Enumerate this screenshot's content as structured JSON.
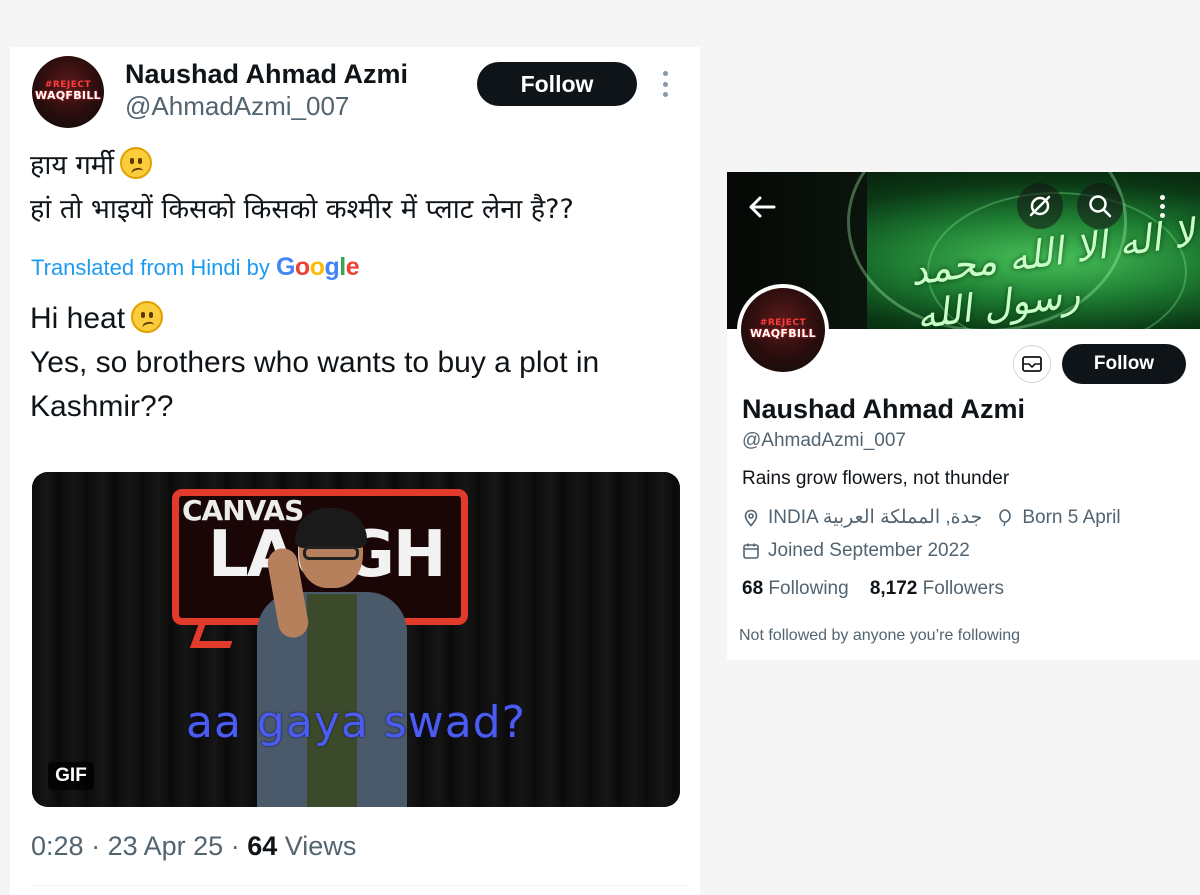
{
  "tweet": {
    "author_name": "Naushad Ahmad Azmi",
    "handle": "@AhmadAzmi_007",
    "follow_label": "Follow",
    "hindi_line1": "हाय गर्मी",
    "hindi_line2": "हां तो भाइयों किसको किसको कश्मीर में प्लाट लेना है??",
    "translated_prefix": "Translated from Hindi by",
    "google_word": "Google",
    "english_line1": "Hi heat",
    "english_line2": "Yes, so brothers who wants to buy a plot in Kashmir??",
    "media": {
      "sign_top": "CANVAS",
      "sign_big": "LAUGH",
      "caption": "aa gaya swad?",
      "badge": "GIF"
    },
    "time": "0:28",
    "date": "23 Apr 25",
    "views_count": "64",
    "views_label": "Views",
    "separator": "·"
  },
  "avatar": {
    "hashtag": "#REJECT",
    "brand": "WAQFBILL"
  },
  "profile": {
    "banner_text": "لا اله الا الله محمد رسول الله",
    "follow_label": "Follow",
    "name": "Naushad Ahmad Azmi",
    "handle": "@AhmadAzmi_007",
    "bio": "Rains grow flowers, not thunder",
    "location": "INDIA جدة, المملكة العربية",
    "born": "Born 5 April",
    "joined": "Joined September 2022",
    "following_count": "68",
    "following_label": "Following",
    "followers_count": "8,172",
    "followers_label": "Followers",
    "not_followed": "Not followed by anyone you’re following"
  },
  "icons": [
    "back-arrow-icon",
    "sync-off-icon",
    "search-icon",
    "more-icon",
    "mail-icon",
    "location-pin-icon",
    "balloon-icon",
    "calendar-icon"
  ]
}
